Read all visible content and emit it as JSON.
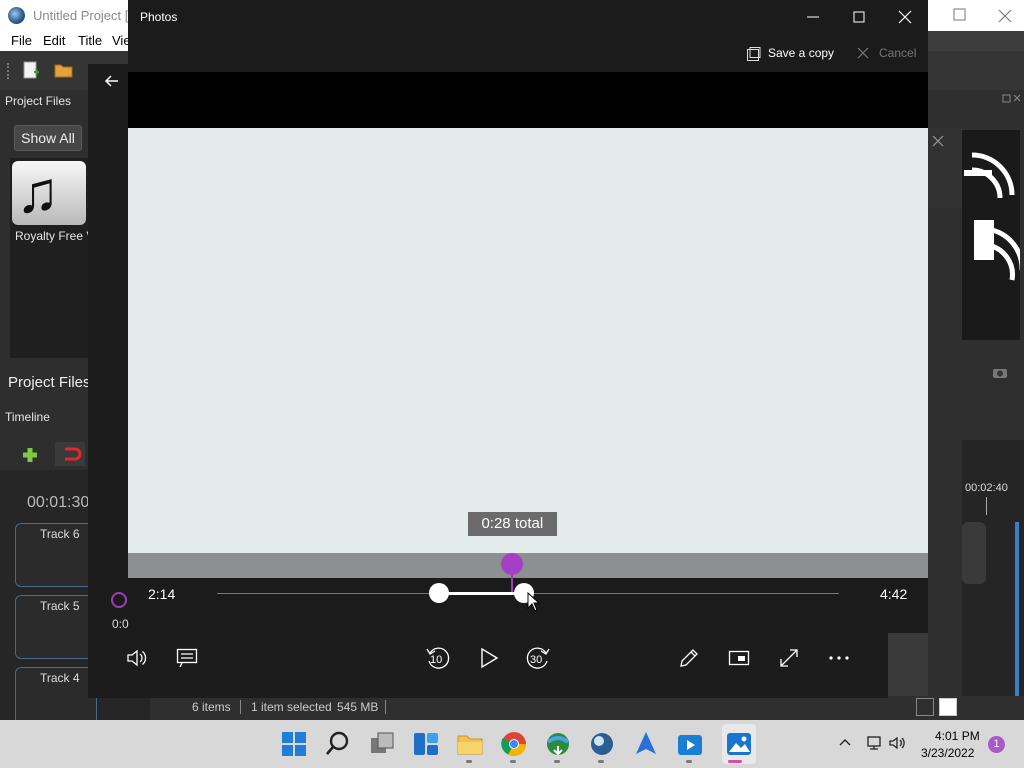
{
  "openshot": {
    "title": "Untitled Project [H",
    "menu": [
      "File",
      "Edit",
      "Title",
      "Vie"
    ],
    "project_files_label": "Project Files",
    "show_all": "Show All",
    "file_name": "Royalty Free V",
    "project_files_tab": "Project Files",
    "timeline_label": "Timeline",
    "timecode": "00:01:30",
    "tracks": [
      "Track 6",
      "Track 5",
      "Track 4"
    ],
    "right_timecode": "00:02:40",
    "left_peek_time": "0:0",
    "status": {
      "items": "6 items",
      "selected": "1 item selected",
      "size": "545 MB"
    }
  },
  "photos": {
    "title": "Photos",
    "save_copy": "Save a copy",
    "cancel": "Cancel",
    "time_start": "2:14",
    "time_end": "4:42",
    "tooltip": "0:28 total",
    "trim_start_fraction": 0.357,
    "trim_end_fraction": 0.493,
    "playhead_fraction": 0.474,
    "controls": {
      "volume": "volume-icon",
      "captions": "captions-icon",
      "rewind": "10",
      "play": "play-icon",
      "forward": "30",
      "edit": "pencil-icon",
      "mini": "mini-view-icon",
      "fullscreen": "fullscreen-icon",
      "more": "more-icon"
    }
  },
  "taskbar": {
    "apps": [
      "start",
      "search",
      "task-view",
      "widgets",
      "file-explorer",
      "chrome",
      "idm",
      "openshot",
      "app-blue",
      "video-editor",
      "photos"
    ],
    "time": "4:01 PM",
    "date": "3/23/2022",
    "notifications": "1"
  },
  "colors": {
    "accent_purple": "#a43fc4",
    "video_frame": "#e4ebeb"
  }
}
